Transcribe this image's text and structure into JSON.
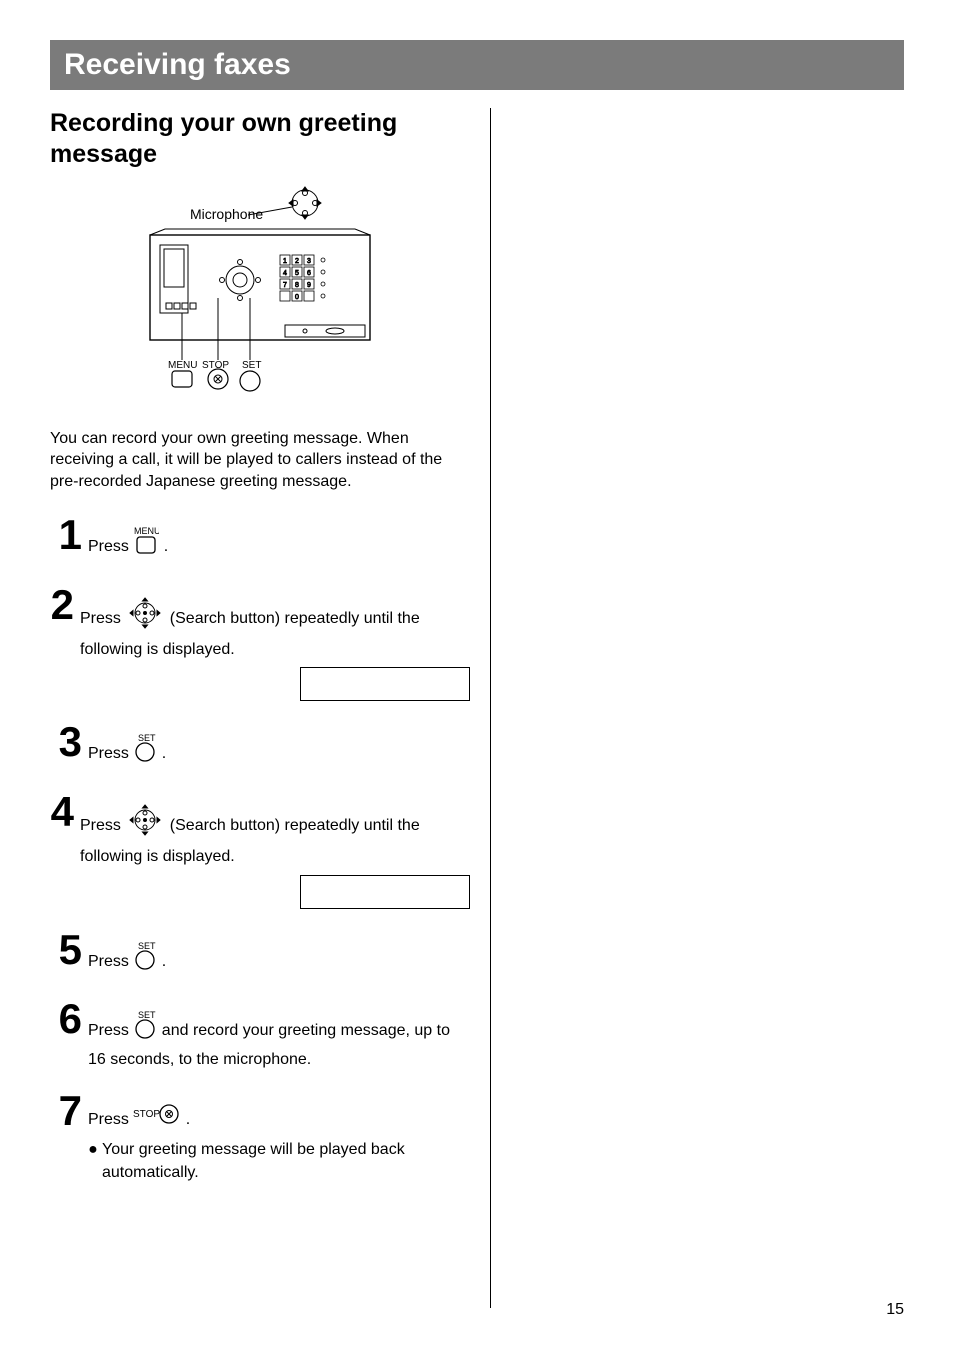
{
  "titleBar": "Receiving faxes",
  "sectionHeading": "Recording your own greeting message",
  "deviceLabel": "Microphone",
  "intro": "You can record your own greeting message. When receiving a call, it will be played to callers instead of the pre-recorded Japanese greeting message.",
  "steps": {
    "s1": {
      "num": "1",
      "text_a": "Press ",
      "text_b": " ."
    },
    "s2": {
      "num": "2",
      "text_a": "Press ",
      "text_b": " (Search button) repeatedly until the following is displayed."
    },
    "s3": {
      "num": "3",
      "text_a": "Press ",
      "text_b": " ."
    },
    "s4": {
      "num": "4",
      "text_a": "Press ",
      "text_b": " (Search button) repeatedly until the following is displayed."
    },
    "s5": {
      "num": "5",
      "text_a": "Press ",
      "text_b": " ."
    },
    "s6": {
      "num": "6",
      "text_a": "Press ",
      "text_b": " and record your greeting message, up to 16 seconds, to the microphone."
    },
    "s7": {
      "num": "7",
      "text_a": "Press ",
      "text_b": " .",
      "bullet": "Your greeting message will be played back automatically."
    }
  },
  "buttonLabels": {
    "menu": "MENU",
    "set": "SET",
    "stop": "STOP"
  },
  "pageNumber": "15"
}
